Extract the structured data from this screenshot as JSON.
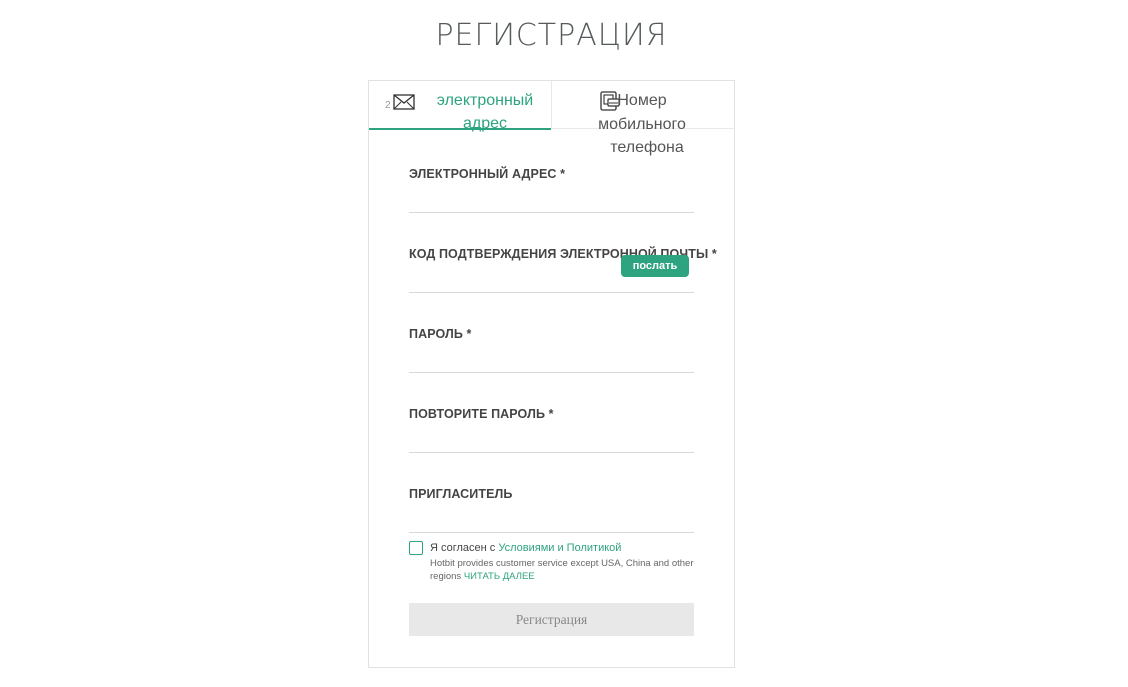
{
  "page": {
    "title": "РЕГИСТРАЦИЯ"
  },
  "tabs": {
    "email": {
      "label": "электронный адрес",
      "mark": "2",
      "icon": "envelope-icon"
    },
    "phone": {
      "label_line1": "Номер мобильного",
      "label_line2": "телефона",
      "icon": "mobile-phone-icon"
    }
  },
  "form": {
    "email_label": "ЭЛЕКТРОННЫЙ АДРЕС *",
    "email_code_label": "КОД ПОДТВЕРЖДЕНИЯ ЭЛЕКТРОННОЙ ПОЧТЫ *",
    "send_button": "послать",
    "password_label": "ПАРОЛЬ *",
    "password_repeat_label": "ПОВТОРИТЕ ПАРОЛЬ *",
    "inviter_label": "ПРИГЛАСИТЕЛЬ"
  },
  "agreement": {
    "prefix": "Я согласен с ",
    "link": "Условиями и Политикой",
    "note": "Hotbit provides customer service except USA, China and other regions ",
    "read_more": "ЧИТАТЬ ДАЛЕЕ"
  },
  "register_button": "Регистрация",
  "colors": {
    "accent": "#2ea37f",
    "button_disabled": "#e8e8e8"
  }
}
